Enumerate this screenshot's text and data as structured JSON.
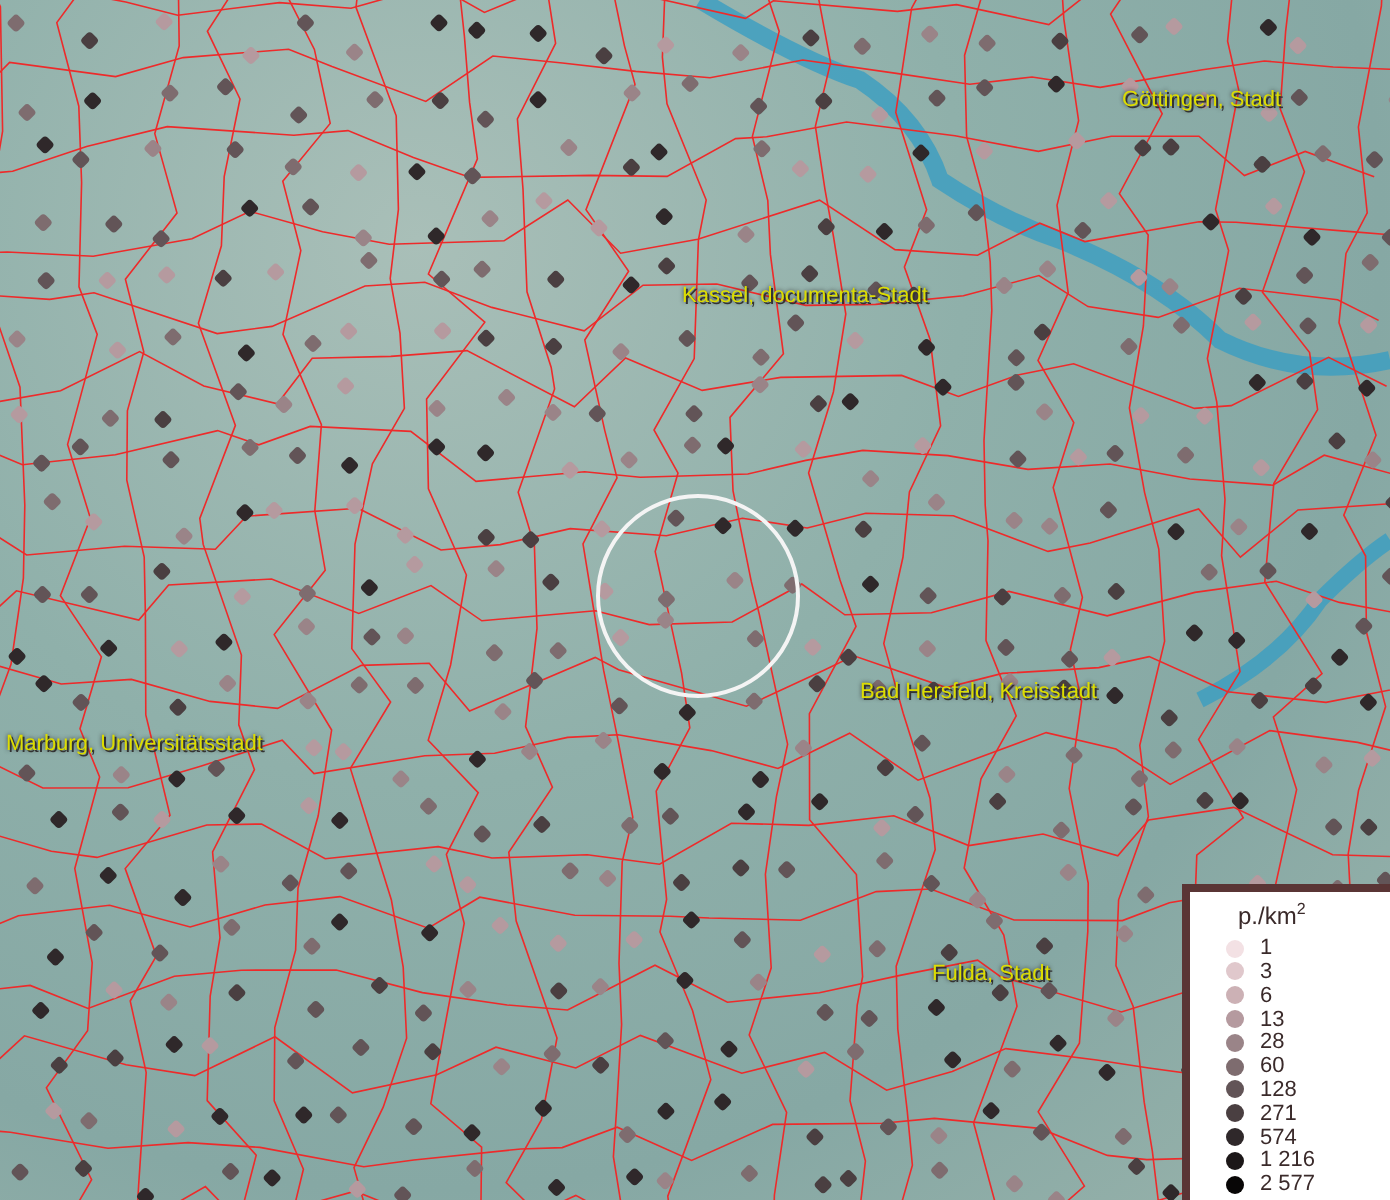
{
  "places": [
    {
      "label": "Göttingen, Stadt"
    },
    {
      "label": "Kassel, documenta-Stadt"
    },
    {
      "label": "Bad Hersfeld, Kreisstadt"
    },
    {
      "label": "Marburg, Universitätsstadt"
    },
    {
      "label": "Fulda, Stadt"
    }
  ],
  "legend": {
    "title": "p./km$^{2}$",
    "items": [
      {
        "label": "1",
        "color": "#f3e1e4"
      },
      {
        "label": "3",
        "color": "#e0c8cc"
      },
      {
        "label": "6",
        "color": "#ccb1b5"
      },
      {
        "label": "13",
        "color": "#b59a9f"
      },
      {
        "label": "28",
        "color": "#9a8488"
      },
      {
        "label": "60",
        "color": "#7e6c6f"
      },
      {
        "label": "128",
        "color": "#625457"
      },
      {
        "label": "271",
        "color": "#4a3f41"
      },
      {
        "label": "574",
        "color": "#2f282a"
      },
      {
        "label": "1 216",
        "color": "#1c1718"
      },
      {
        "label": "2 577",
        "color": "#080606"
      }
    ]
  }
}
